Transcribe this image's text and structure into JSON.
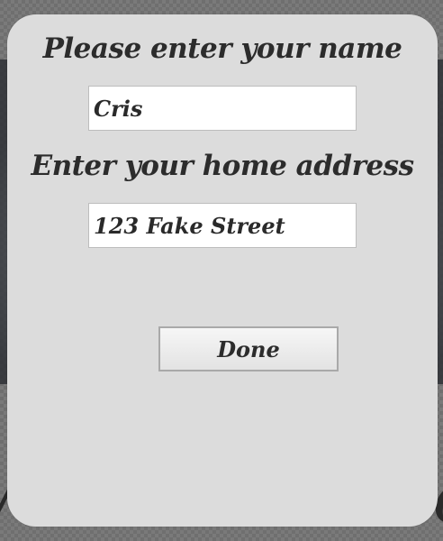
{
  "form": {
    "name_label": "Please enter your name",
    "name_value": "Cris",
    "address_label": "Enter your home address",
    "address_value": "123 Fake Street",
    "done_label": "Done"
  },
  "colors": {
    "dialog_background": "#dcdcdc",
    "text": "#2c2c2c",
    "input_background": "#ffffff"
  }
}
